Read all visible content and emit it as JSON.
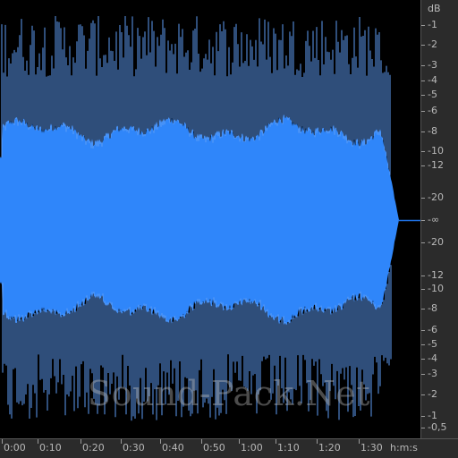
{
  "colors": {
    "background": "#000000",
    "waveform_fill": "#2f86fa",
    "waveform_edge": "#1e6fe0",
    "waveform_spike": "#5e9df5",
    "ruler_bg": "#2b2b2b",
    "ruler_text": "#b8b8b8"
  },
  "watermark": "Sound-Pack.Net",
  "vertical_ruler": {
    "unit": "dB",
    "labels": [
      "-1",
      "-2",
      "-3",
      "-4",
      "-5",
      "-6",
      "-8",
      "-10",
      "-12",
      "-20",
      "-∞",
      "-20",
      "-12",
      "-10",
      "-8",
      "-6",
      "-5",
      "-4",
      "-3",
      "-2",
      "-1",
      "-0,5"
    ]
  },
  "time_ruler": {
    "unit": "h:m:s",
    "labels": [
      "0:00",
      "0:10",
      "0:20",
      "0:30",
      "0:40",
      "0:50",
      "1:00",
      "1:10",
      "1:20",
      "1:30"
    ]
  }
}
